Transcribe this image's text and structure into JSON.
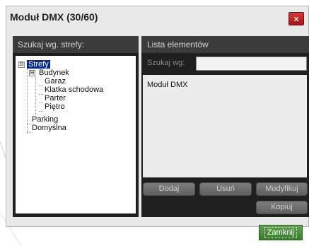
{
  "dialog": {
    "title": "Moduł DMX (30/60)",
    "close_icon": "x-icon",
    "close_glyph": "×"
  },
  "left_panel": {
    "header": "Szukaj wg. strefy:",
    "tree": {
      "root": {
        "label": "Strefy",
        "expander": "⊟"
      },
      "budynek": {
        "label": "Budynek",
        "expander": "⊟"
      },
      "children": [
        "Garaz",
        "Klatka schodowa",
        "Parter",
        "Piętro"
      ],
      "siblings": [
        "Parking",
        "Domyślna"
      ]
    }
  },
  "right_panel": {
    "header": "Lista elementów",
    "search_label": "Szukaj wg:",
    "search_value": "",
    "items": [
      "Moduł DMX"
    ],
    "buttons": {
      "add": "Dodaj",
      "remove": "Usuń",
      "modify": "Modyfikuj",
      "copy": "Kopiuj"
    }
  },
  "footer": {
    "close_label": "Zamknij"
  },
  "colors": {
    "panel_dark": "#1f1f1f",
    "header_gray": "#3b3b3b",
    "close_red": "#c02323",
    "close_green": "#4e8f3f",
    "selection_blue": "#0a2a8f"
  }
}
